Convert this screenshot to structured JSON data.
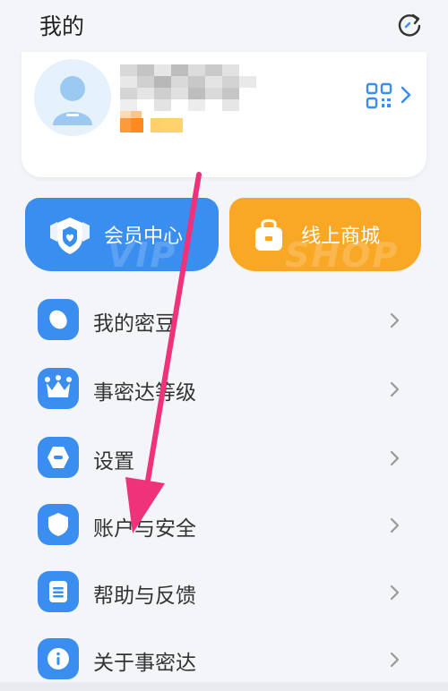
{
  "header": {
    "title": "我的",
    "refresh_icon": "refresh-icon"
  },
  "profile": {
    "qr_icon": "qr-code-icon"
  },
  "banners": {
    "vip": {
      "label": "会员中心",
      "watermark": "VIP",
      "color": "#3a8ef0",
      "icon": "vip-shield-icon"
    },
    "shop": {
      "label": "线上商城",
      "watermark": "SHOP",
      "color": "#f9a826",
      "icon": "shopping-bag-icon"
    }
  },
  "menu": [
    {
      "label": "我的密豆",
      "icon": "bean-icon"
    },
    {
      "label": "事密达等级",
      "icon": "crown-icon"
    },
    {
      "label": "设置",
      "icon": "settings-icon"
    },
    {
      "label": "账户与安全",
      "icon": "shield-icon"
    },
    {
      "label": "帮助与反馈",
      "icon": "document-icon"
    },
    {
      "label": "关于事密达",
      "icon": "info-icon"
    }
  ],
  "colors": {
    "accent": "#3a8ef0",
    "shop": "#f9a826",
    "annotation_arrow": "#f0327a"
  }
}
